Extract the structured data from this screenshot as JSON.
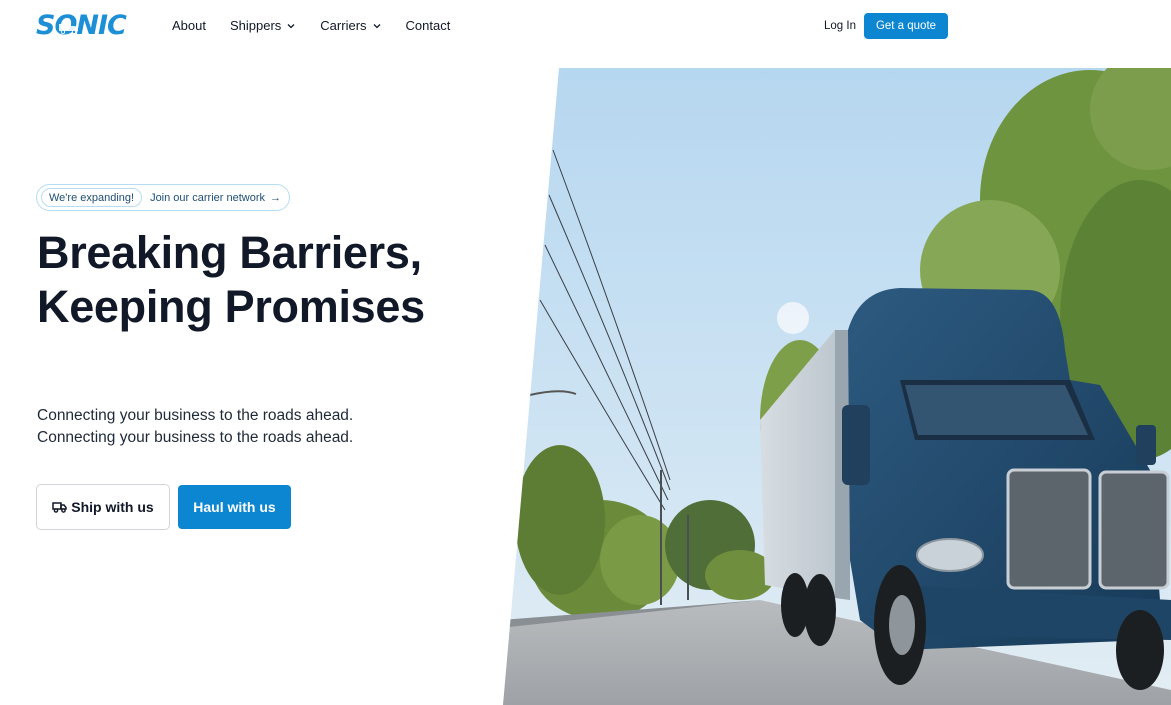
{
  "brand": {
    "name": "SONIC",
    "color": "#1d8fd6"
  },
  "nav": {
    "items": [
      {
        "label": "About",
        "dropdown": false
      },
      {
        "label": "Shippers",
        "dropdown": true
      },
      {
        "label": "Carriers",
        "dropdown": true
      },
      {
        "label": "Contact",
        "dropdown": false
      }
    ],
    "login_label": "Log In",
    "quote_label": "Get a quote"
  },
  "hero": {
    "badge": "We're expanding!",
    "badge_link": "Join our carrier network",
    "headline": "Breaking Barriers, Keeping Promises",
    "subtitle_line1": "Connecting your business to the roads ahead.",
    "subtitle_line2": "Connecting your business to the roads ahead.",
    "ship_label": "Ship with us",
    "haul_label": "Haul with us",
    "image_subject": "blue semi-truck on a tree-lined road"
  },
  "colors": {
    "accent": "#0c86d0",
    "text": "#111827"
  },
  "icons": [
    "truck-icon",
    "chevron-down-icon",
    "arrow-right-icon"
  ]
}
